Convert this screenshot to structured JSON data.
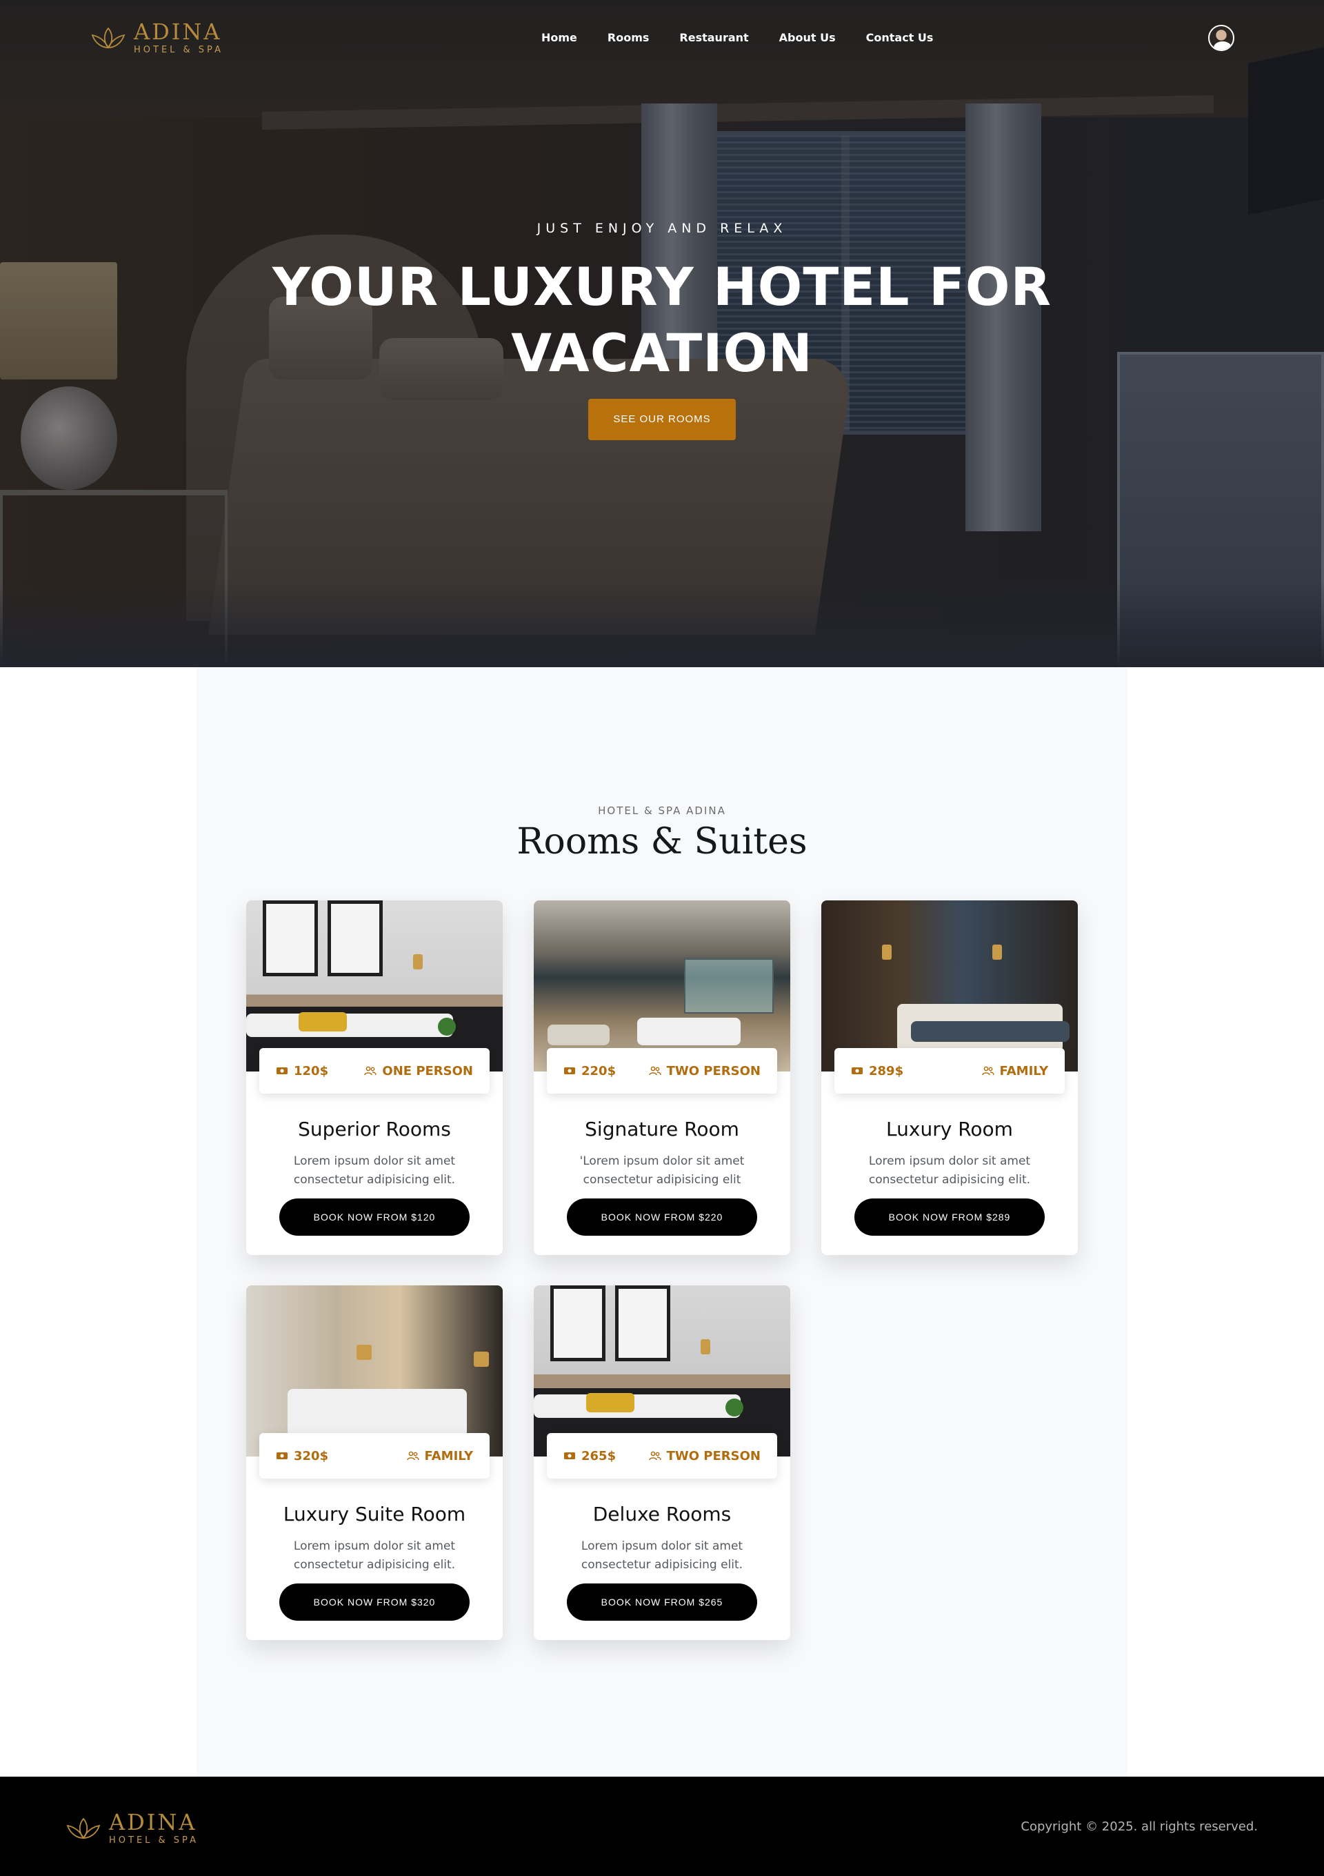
{
  "brand": {
    "name": "ADINA",
    "tagline": "HOTEL & SPA",
    "accent_color": "#b9710c",
    "logo_icon": "lotus-icon"
  },
  "nav": {
    "items": [
      {
        "label": "Home"
      },
      {
        "label": "Rooms"
      },
      {
        "label": "Restaurant"
      },
      {
        "label": "About Us"
      },
      {
        "label": "Contact Us"
      }
    ],
    "avatar_icon": "user-avatar"
  },
  "hero": {
    "eyebrow": "JUST ENJOY AND RELAX",
    "title_line1": "YOUR LUXURY HOTEL FOR",
    "title_line2": "VACATION",
    "cta_label": "SEE OUR ROOMS"
  },
  "rooms": {
    "eyebrow": "HOTEL & SPA ADINA",
    "title": "Rooms & Suites",
    "cards": [
      {
        "price": "120$",
        "capacity": "ONE PERSON",
        "title": "Superior Rooms",
        "desc": "Lorem ipsum dolor sit amet consectetur adipisicing elit.",
        "button": "BOOK NOW FROM $120"
      },
      {
        "price": "220$",
        "capacity": "TWO PERSON",
        "title": "Signature Room",
        "desc": "'Lorem ipsum dolor sit amet consectetur adipisicing elit",
        "button": "BOOK NOW FROM $220"
      },
      {
        "price": "289$",
        "capacity": "FAMILY",
        "title": "Luxury Room",
        "desc": "Lorem ipsum dolor sit amet consectetur adipisicing elit.",
        "button": "BOOK NOW FROM $289"
      },
      {
        "price": "320$",
        "capacity": "FAMILY",
        "title": "Luxury Suite Room",
        "desc": "Lorem ipsum dolor sit amet consectetur adipisicing elit.",
        "button": "BOOK NOW FROM $320"
      },
      {
        "price": "265$",
        "capacity": "TWO PERSON",
        "title": "Deluxe Rooms",
        "desc": "Lorem ipsum dolor sit amet consectetur adipisicing elit.",
        "button": "BOOK NOW FROM $265"
      }
    ],
    "icons": {
      "price": "money-icon",
      "capacity": "people-icon"
    }
  },
  "footer": {
    "copyright": "Copyright © 2025. all rights reserved."
  }
}
